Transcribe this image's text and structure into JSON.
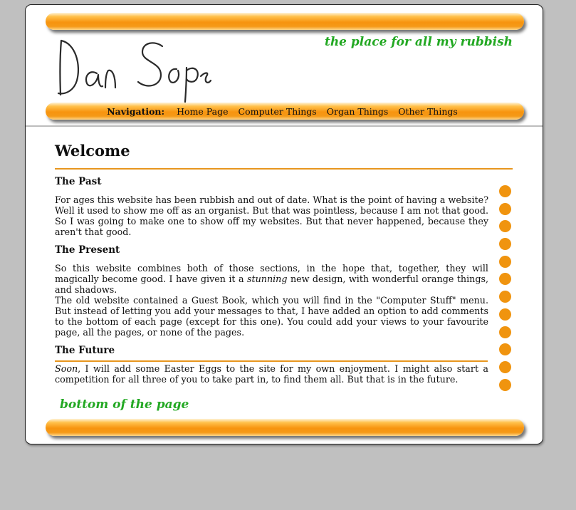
{
  "header": {
    "signature_text": "Dan Soper",
    "tagline": "the place for all my rubbish"
  },
  "nav": {
    "label": "Navigation:",
    "items": [
      {
        "label": "Home Page"
      },
      {
        "label": "Computer Things"
      },
      {
        "label": "Organ Things"
      },
      {
        "label": "Other Things"
      }
    ]
  },
  "main": {
    "title": "Welcome",
    "sections": [
      {
        "heading": "The Past",
        "paragraphs": [
          "For ages this website has been rubbish and out of date. What is the point of having a website? Well it used to show me off as an organist. But that was pointless, because I am not that good. So I was going to make one to show off my websites. But that never happened, because they aren't that good."
        ]
      },
      {
        "heading": "The Present",
        "p1_before": "So this website combines both of those sections, in the hope that, together, they will magically become good. I have given it a ",
        "p1_em": "stunning",
        "p1_after": " new design, with wonderful orange things, and shadows.",
        "p2": "The old website contained a Guest Book, which you will find in the \"Computer Stuff\" menu. But instead of letting you add your messages to that, I have added an option to add comments to the bottom of each page (except for this one). You could add your views to your favourite page, all the pages, or none of the pages."
      },
      {
        "heading": "The Future",
        "p_em": "Soon",
        "p_after": ", I will add some Easter Eggs to the site for my own enjoyment. I might also start a competition for all three of you to take part in, to find them all. But that is in the future."
      }
    ]
  },
  "footer": {
    "text": "bottom of the page"
  },
  "colors": {
    "accent_orange": "#f0940f",
    "tagline_green": "#22a822",
    "page_background": "#c0c0c0"
  }
}
